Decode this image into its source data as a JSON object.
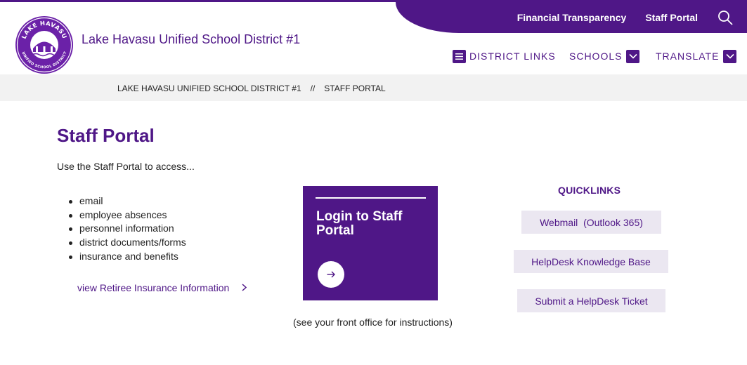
{
  "header": {
    "site_title": "Lake Havasu Unified School District #1",
    "logo": {
      "arc_top": "LAKE HAVASU",
      "arc_bottom": "UNIFIED SCHOOL DISTRICT"
    },
    "utility_links": {
      "financial": "Financial Transparency",
      "staff_portal": "Staff Portal"
    },
    "nav": {
      "district_links": "DISTRICT LINKS",
      "schools": "SCHOOLS",
      "translate": "TRANSLATE"
    }
  },
  "breadcrumb": {
    "home": "LAKE HAVASU UNIFIED SCHOOL DISTRICT #1",
    "separator": "//",
    "current": "STAFF PORTAL"
  },
  "main": {
    "title": "Staff Portal",
    "intro": "Use the Staff Portal to access...",
    "access_items": [
      "email",
      "employee absences",
      "personnel information",
      "district documents/forms",
      "insurance and benefits"
    ],
    "retiree_link": "view Retiree Insurance Information",
    "login_card_title": "Login to Staff Portal",
    "front_office_note": "(see your front office for instructions)"
  },
  "quicklinks": {
    "title": "QUICKLINKS",
    "links": [
      "Webmail  (Outlook 365)",
      "HelpDesk Knowledge Base",
      "Submit a HelpDesk Ticket"
    ]
  },
  "colors": {
    "brand_purple": "#4f1787",
    "quicklink_bg": "#ebe7f1",
    "breadcrumb_bg": "#f2f2f2"
  }
}
